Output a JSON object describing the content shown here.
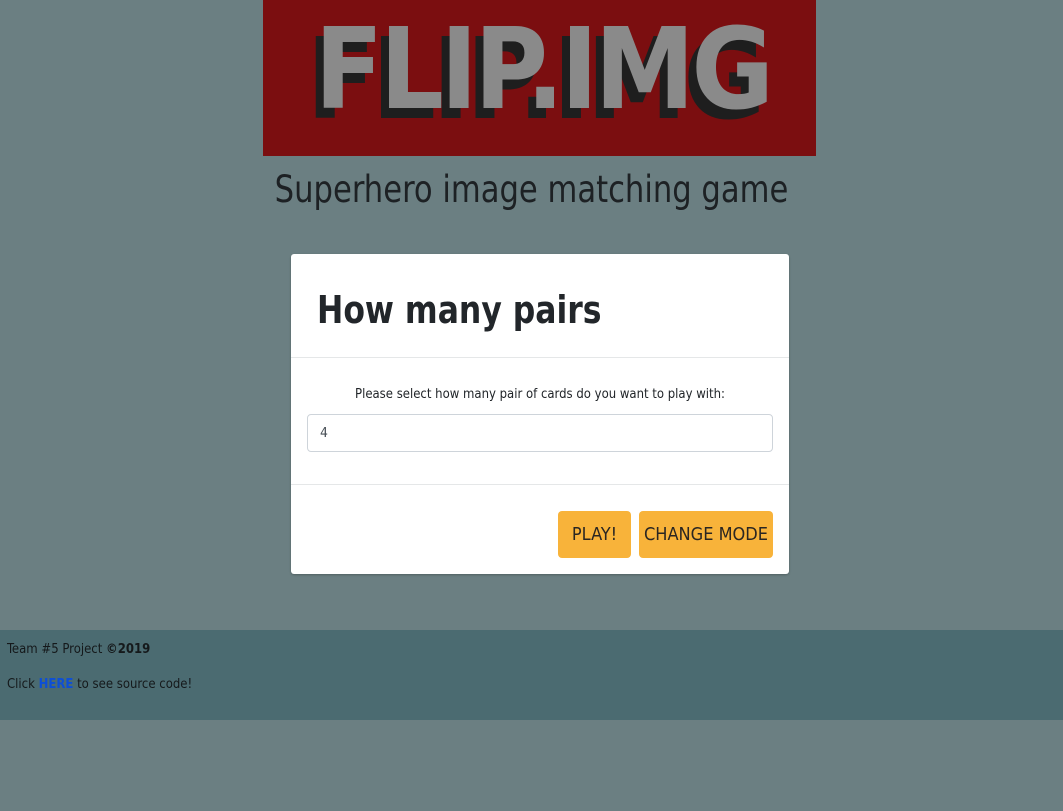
{
  "logo": {
    "text": "FLIP.IMG",
    "colors": {
      "background": "#7b0e10",
      "front": "#8a8a8a",
      "shadow": "#1e1e1e"
    }
  },
  "subtitle": "Superhero image matching game",
  "modal": {
    "title": "How many pairs",
    "prompt": "Please select how many pair of cards do you want to play with:",
    "input_value": "4",
    "play_label": "PLAY!",
    "change_mode_label": "CHANGE MODE",
    "button_color": "#f8b33a"
  },
  "footer": {
    "team_text": "Team #5 Project",
    "copyright": "©2019",
    "click_text": "Click",
    "link_text": "HERE",
    "after_link_text": "to see source code!",
    "link_color": "#0d4fd6"
  }
}
